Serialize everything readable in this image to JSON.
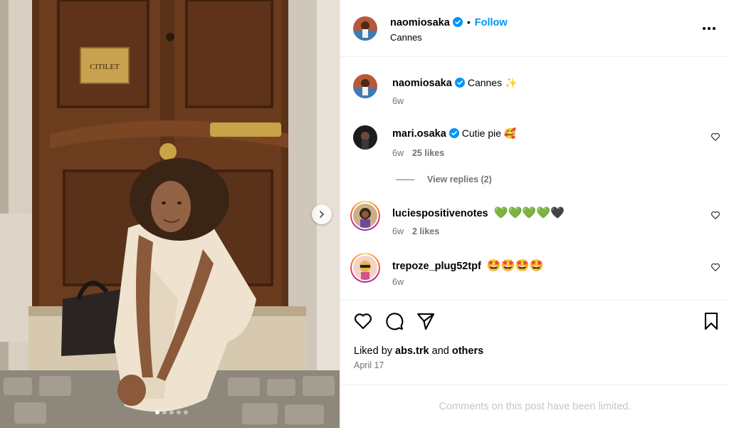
{
  "post": {
    "author": "naomiosaka",
    "follow_label": "Follow",
    "separator": "•",
    "location": "Cannes",
    "caption_text": "Cannes ✨",
    "caption_time": "6w",
    "photo_plaque_text": "CITILET",
    "photo_count": 5,
    "active_photo_index": 1,
    "liked_by_prefix": "Liked by",
    "liked_by_user": "abs.trk",
    "liked_by_and": "and",
    "liked_by_others": "others",
    "date": "April 17",
    "comments_limited": "Comments on this post have been limited."
  },
  "comments": [
    {
      "username": "mari.osaka",
      "verified": true,
      "text": "Cutie pie 🥰",
      "time": "6w",
      "likes": "25 likes"
    },
    {
      "username": "luciespositivenotes",
      "verified": false,
      "text": "💚💚💚💚🖤",
      "time": "6w",
      "likes": "2 likes"
    },
    {
      "username": "trepoze_plug52tpf",
      "verified": false,
      "text": "🤩🤩🤩🤩",
      "time": "6w",
      "likes": ""
    }
  ],
  "view_replies": "View replies (2)",
  "icons": {
    "verified": "verified-badge-icon",
    "more": "more-options-icon",
    "like": "heart-icon",
    "comment": "comment-icon",
    "share": "share-icon",
    "save": "bookmark-icon",
    "next": "chevron-right-icon"
  },
  "colors": {
    "accent": "#0095f6",
    "muted": "#737373",
    "limited": "#c7c7c7"
  }
}
